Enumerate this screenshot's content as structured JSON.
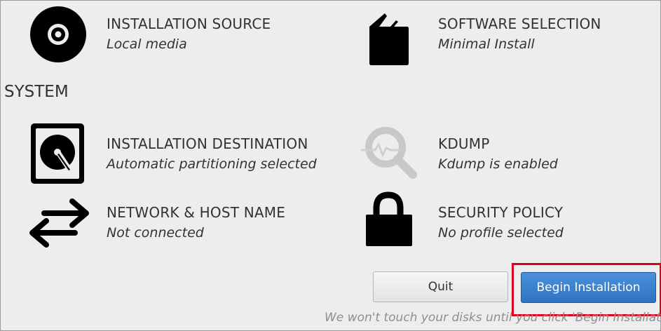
{
  "localization": {
    "installation_source": {
      "title": "INSTALLATION SOURCE",
      "status": "Local media",
      "icon": "optical-disc-icon"
    },
    "software_selection": {
      "title": "SOFTWARE SELECTION",
      "status": "Minimal Install",
      "icon": "package-icon"
    }
  },
  "system": {
    "heading": "SYSTEM",
    "installation_destination": {
      "title": "INSTALLATION DESTINATION",
      "status": "Automatic partitioning selected",
      "icon": "hard-disk-icon"
    },
    "kdump": {
      "title": "KDUMP",
      "status": "Kdump is enabled",
      "icon": "magnifier-icon"
    },
    "network_host_name": {
      "title": "NETWORK & HOST NAME",
      "status": "Not connected",
      "icon": "network-arrows-icon"
    },
    "security_policy": {
      "title": "SECURITY POLICY",
      "status": "No profile selected",
      "icon": "padlock-icon"
    }
  },
  "actions": {
    "quit_label": "Quit",
    "begin_label": "Begin Installation",
    "note": "We won't touch your disks until you click 'Begin Installation'."
  },
  "colors": {
    "background": "#ededed",
    "text": "#2e3436",
    "primary_button": "#3a82d0",
    "highlight": "#e0001b",
    "muted": "#8a8f91"
  }
}
